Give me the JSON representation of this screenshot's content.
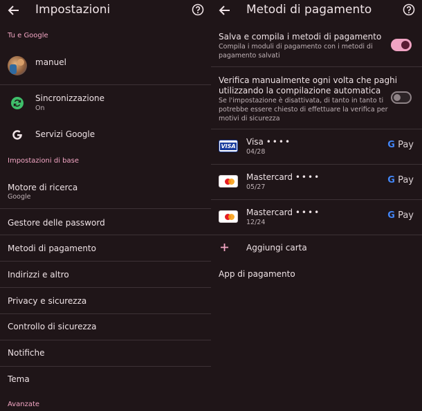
{
  "left": {
    "title": "Impostazioni",
    "section_you_google": "Tu e Google",
    "account_name": "manuel",
    "sync_label": "Sincronizzazione",
    "sync_status": "On",
    "google_services": "Servizi Google",
    "section_basics": "Impostazioni di base",
    "search_engine_label": "Motore di ricerca",
    "search_engine_value": "Google",
    "items": [
      "Gestore delle password",
      "Metodi di pagamento",
      "Indirizzi e altro",
      "Privacy e sicurezza",
      "Controllo di sicurezza",
      "Notifiche",
      "Tema"
    ],
    "section_advanced": "Avanzate"
  },
  "right": {
    "title": "Metodi di pagamento",
    "save_fill_label": "Salva e compila i metodi di pagamento",
    "save_fill_desc_1": "Compila i moduli di pagamento con i metodi di",
    "save_fill_desc_2": "pagamento salvati",
    "save_fill_enabled": true,
    "verify_label_1": "Verifica manualmente ogni volta che paghi",
    "verify_label_2": "utilizzando la compilazione automatica",
    "verify_desc_1": "Se l'impostazione è disattivata, di tanto in tanto ti",
    "verify_desc_2": "potrebbe essere chiesto di effettuare la verifica per",
    "verify_desc_3": "motivi di sicurezza",
    "verify_enabled": false,
    "cards": [
      {
        "brand": "Visa",
        "mask": "••••",
        "expiry": "04/28",
        "icon": "visa-card-icon",
        "wallet": "G Pay"
      },
      {
        "brand": "Mastercard",
        "mask": "••••",
        "expiry": "05/27",
        "icon": "mastercard-icon",
        "wallet": "G Pay"
      },
      {
        "brand": "Mastercard",
        "mask": "••••",
        "expiry": "12/24",
        "icon": "mastercard-icon",
        "wallet": "G Pay"
      }
    ],
    "add_card": "Aggiungi carta",
    "payment_apps": "App di pagamento"
  },
  "colors": {
    "background": "#1f1518",
    "accent_pink": "#f3a6c4",
    "toggle_on": "#f0a3c3",
    "divider": "#3d3236"
  }
}
